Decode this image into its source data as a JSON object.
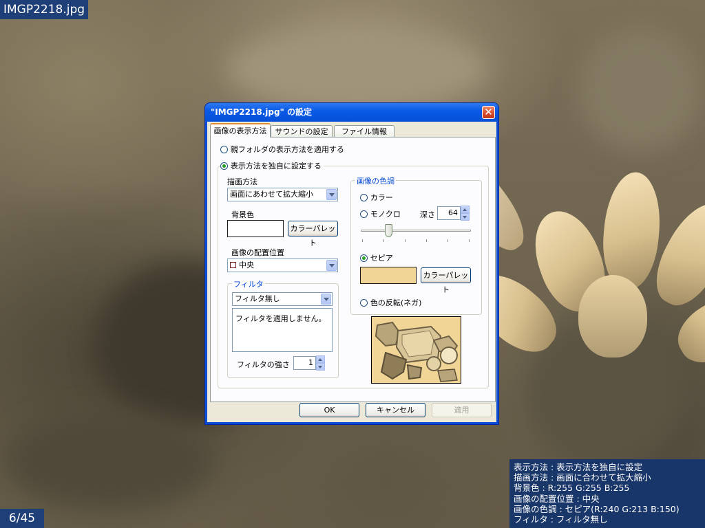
{
  "viewer": {
    "filename": "IMGP2218.jpg",
    "counter": "6/45",
    "info_lines": [
      "表示方法 : 表示方法を独自に設定",
      "描画方法 : 画面に合わせて拡大縮小",
      "背景色 : R:255 G:255 B:255",
      "画像の配置位置 : 中央",
      "画像の色調 : セピア(R:240 G:213 B:150)",
      "フィルタ : フィルタ無し"
    ]
  },
  "dialog": {
    "title": "\"IMGP2218.jpg\" の設定",
    "close_glyph": "✕",
    "tabs": [
      "画像の表示方法",
      "サウンドの設定",
      "ファイル情報"
    ],
    "radio_parent": "親フォルダの表示方法を適用する",
    "radio_custom": "表示方法を独自に設定する",
    "draw_method_label": "描画方法",
    "draw_method_value": "画面にあわせて拡大縮小",
    "bg_color_label": "背景色",
    "bg_color_hex": "#ffffff",
    "palette_button": "カラーパレット",
    "position_label": "画像の配置位置",
    "position_value": "中央",
    "filter_group": "フィルタ",
    "filter_value": "フィルタ無し",
    "filter_description": "フィルタを適用しません。",
    "filter_strength_label": "フィルタの強さ",
    "filter_strength_value": "1",
    "tone_group": "画像の色調",
    "tone_color": "カラー",
    "tone_mono": "モノクロ",
    "depth_label": "深さ",
    "depth_value": "64",
    "depth_level": 0.25,
    "tone_sepia": "セピア",
    "sepia_color_hex": "#f0d596",
    "palette_button_2": "カラーパレット",
    "tone_invert": "色の反転(ネガ)",
    "ok": "OK",
    "cancel": "キャンセル",
    "apply": "適用"
  },
  "colors": {
    "title_bar": "#0a5ae6",
    "accent_tab": "#e68b2c",
    "overlay_blue": "#1f3f78",
    "radio_dot": "#21a121"
  }
}
